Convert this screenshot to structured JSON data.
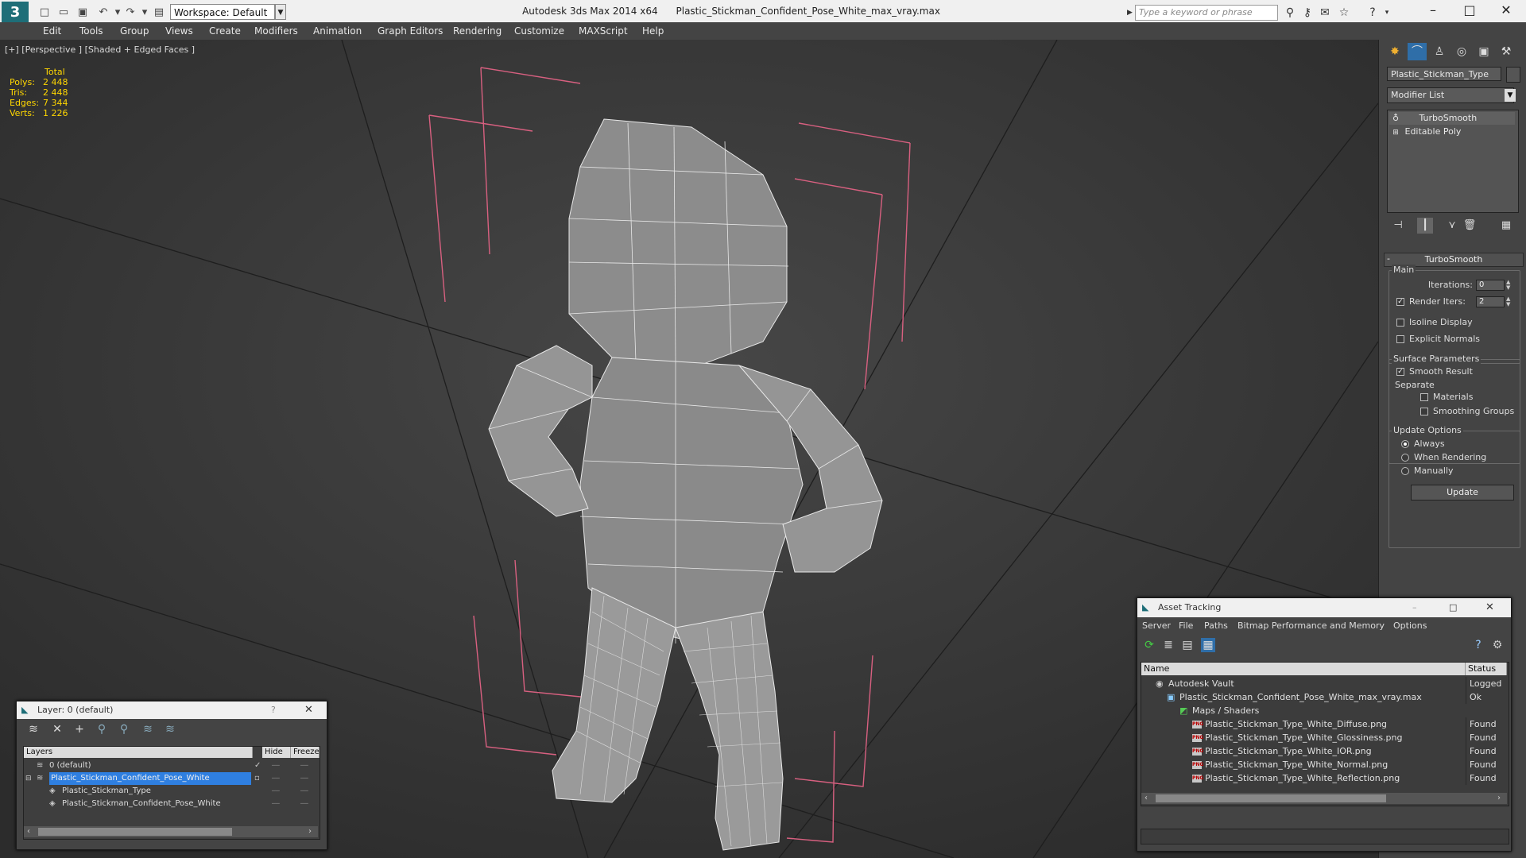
{
  "titlebar": {
    "logo": "3",
    "workspace": "Workspace: Default",
    "app_name": "Autodesk 3ds Max  2014 x64",
    "file_name": "Plastic_Stickman_Confident_Pose_White_max_vray.max",
    "search_placeholder": "Type a keyword or phrase"
  },
  "menu": [
    "Edit",
    "Tools",
    "Group",
    "Views",
    "Create",
    "Modifiers",
    "Animation",
    "Graph Editors",
    "Rendering",
    "Customize",
    "MAXScript",
    "Help"
  ],
  "viewport": {
    "label": "[+] [Perspective ] [Shaded + Edged Faces ]",
    "stats": {
      "header": "Total",
      "rows": [
        {
          "label": "Polys:",
          "value": "2 448"
        },
        {
          "label": "Tris:",
          "value": "2 448"
        },
        {
          "label": "Edges:",
          "value": "7 344"
        },
        {
          "label": "Verts:",
          "value": "1 226"
        }
      ]
    }
  },
  "command_panel": {
    "object_name": "Plastic_Stickman_Type",
    "modifier_list": "Modifier List",
    "stack": [
      "TurboSmooth",
      "Editable Poly"
    ],
    "rollout_title": "TurboSmooth",
    "main_group": "Main",
    "iterations_label": "Iterations:",
    "iterations_value": "0",
    "render_iters_label": "Render Iters:",
    "render_iters_value": "2",
    "isoline_display": "Isoline Display",
    "explicit_normals": "Explicit Normals",
    "surface_params": "Surface Parameters",
    "smooth_result": "Smooth Result",
    "separate": "Separate",
    "materials": "Materials",
    "smoothing_groups": "Smoothing Groups",
    "update_options": "Update Options",
    "always": "Always",
    "when_rendering": "When Rendering",
    "manually": "Manually",
    "update_button": "Update"
  },
  "layer_window": {
    "title": "Layer: 0 (default)",
    "help": "?",
    "columns": [
      "Layers",
      "Hide",
      "Freeze"
    ],
    "rows": [
      {
        "name": "0 (default)",
        "selected": false,
        "indent": 1
      },
      {
        "name": "Plastic_Stickman_Confident_Pose_White",
        "selected": true,
        "indent": 1
      },
      {
        "name": "Plastic_Stickman_Type",
        "selected": false,
        "indent": 2
      },
      {
        "name": "Plastic_Stickman_Confident_Pose_White",
        "selected": false,
        "indent": 2
      }
    ]
  },
  "asset_tracking": {
    "title": "Asset Tracking",
    "menu": [
      "Server",
      "File",
      "Paths",
      "Bitmap Performance and Memory",
      "Options"
    ],
    "columns": [
      "Name",
      "Status"
    ],
    "rows": [
      {
        "name": "Autodesk Vault",
        "status": "Logged",
        "indent": 1,
        "icon": "vault-icon"
      },
      {
        "name": "Plastic_Stickman_Confident_Pose_White_max_vray.max",
        "status": "Ok",
        "indent": 2,
        "icon": "max-file-icon"
      },
      {
        "name": "Maps / Shaders",
        "status": "",
        "indent": 3,
        "icon": "maps-icon"
      },
      {
        "name": "Plastic_Stickman_Type_White_Diffuse.png",
        "status": "Found",
        "indent": 4,
        "icon": "png-icon"
      },
      {
        "name": "Plastic_Stickman_Type_White_Glossiness.png",
        "status": "Found",
        "indent": 4,
        "icon": "png-icon"
      },
      {
        "name": "Plastic_Stickman_Type_White_IOR.png",
        "status": "Found",
        "indent": 4,
        "icon": "png-icon"
      },
      {
        "name": "Plastic_Stickman_Type_White_Normal.png",
        "status": "Found",
        "indent": 4,
        "icon": "png-icon"
      },
      {
        "name": "Plastic_Stickman_Type_White_Reflection.png",
        "status": "Found",
        "indent": 4,
        "icon": "png-icon"
      }
    ]
  },
  "colors": {
    "accent_selection": "#2f7fe0",
    "stats_text": "#ffd700",
    "bbox_lines": "#d86080"
  }
}
